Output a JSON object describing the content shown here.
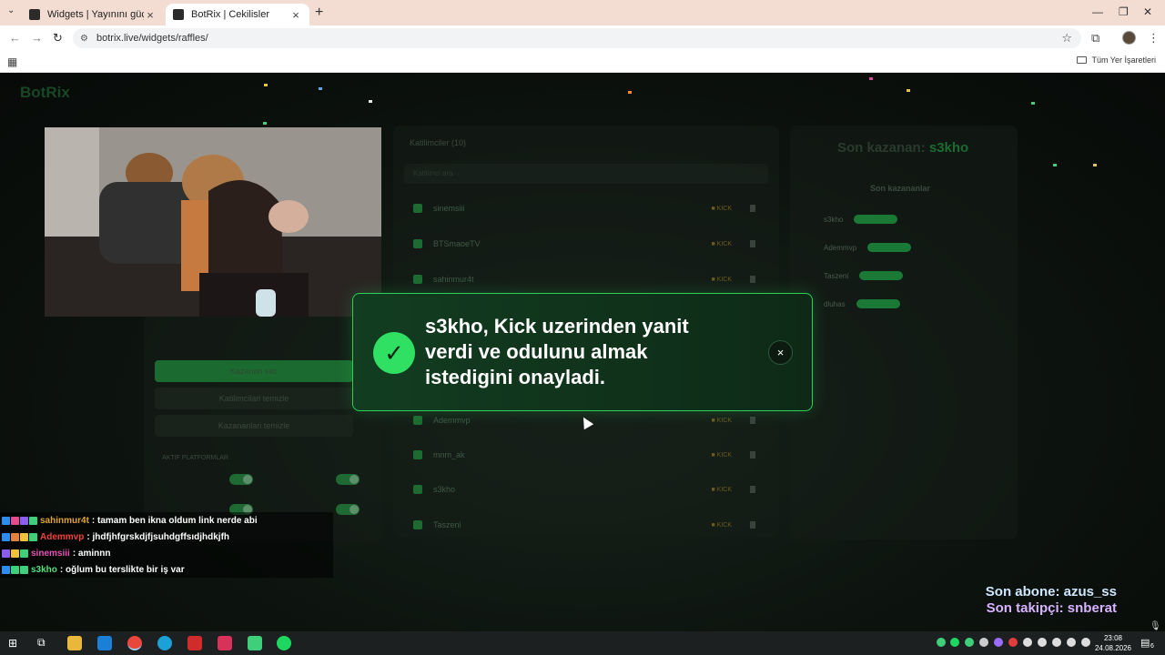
{
  "browser": {
    "tabs": [
      {
        "title": "Widgets | Yayınını güçlendirmek"
      },
      {
        "title": "BotRix | Cekilisler"
      }
    ],
    "url": "botrix.live/widgets/raffles/",
    "bookmarks_label": "Tüm Yer İşaretleri"
  },
  "widget": {
    "logo": "BotRix",
    "entrants_header": "Katilimciler (10)",
    "search_placeholder": "Katilimci ara",
    "entrants": [
      "sinemsiii",
      "BTSmaoeTV",
      "sahinmur4t",
      "Ademmvp",
      "mnm_ak",
      "s3kho",
      "Taszeni"
    ],
    "last_winner_label": "Son kazanan:",
    "last_winner": "s3kho",
    "winners_header": "Son kazananlar",
    "winners": [
      "s3kho",
      "Ademmvp",
      "Taszeni",
      "dluhas"
    ],
    "left_buttons": [
      "Kazanan sec",
      "Katilimcilari temizle",
      "Kazananlari temizle"
    ],
    "platforms_label": "AKTIF PLATFORMLAR"
  },
  "notification": {
    "message": "s3kho, Kick uzerinden yanit verdi ve odulunu almak istedigini onayladi.",
    "close_label": "×",
    "check": "✓"
  },
  "chat": [
    {
      "user": "sahinmur4t",
      "color": "#e0a435",
      "text": ": tamam ben ikna oldum link nerde abi",
      "badges": [
        "#2d8cf0",
        "#e64b8c",
        "#8a5cf0",
        "#3fcf7a"
      ]
    },
    {
      "user": "Ademmvp",
      "color": "#f0423c",
      "text": ": jhdfjhfgrskdjfjsuhdgffsıdjhdkjfh",
      "badges": [
        "#2d8cf0",
        "#e6813c",
        "#f0c23c",
        "#3fcf7a"
      ]
    },
    {
      "user": "sinemsiii",
      "color": "#e653b5",
      "text": ": aminnn",
      "badges": [
        "#8a5cf0",
        "#f0c23c",
        "#3fcf7a"
      ]
    },
    {
      "user": "s3kho",
      "color": "#53e07a",
      "text": ": oğlum bu terslikte bir iş var",
      "badges": [
        "#2d8cf0",
        "#3fcf7a",
        "#3fcf7a"
      ]
    }
  ],
  "stats": {
    "sub_line": "Son abone: azus_ss",
    "follow_line": "Son takipçi: snberat",
    "sub_color": "#cfe7ff",
    "follow_color": "#d9b3ff"
  },
  "taskbar": {
    "time": "23:08",
    "date": "24.08.2026",
    "notif_count": "6"
  }
}
